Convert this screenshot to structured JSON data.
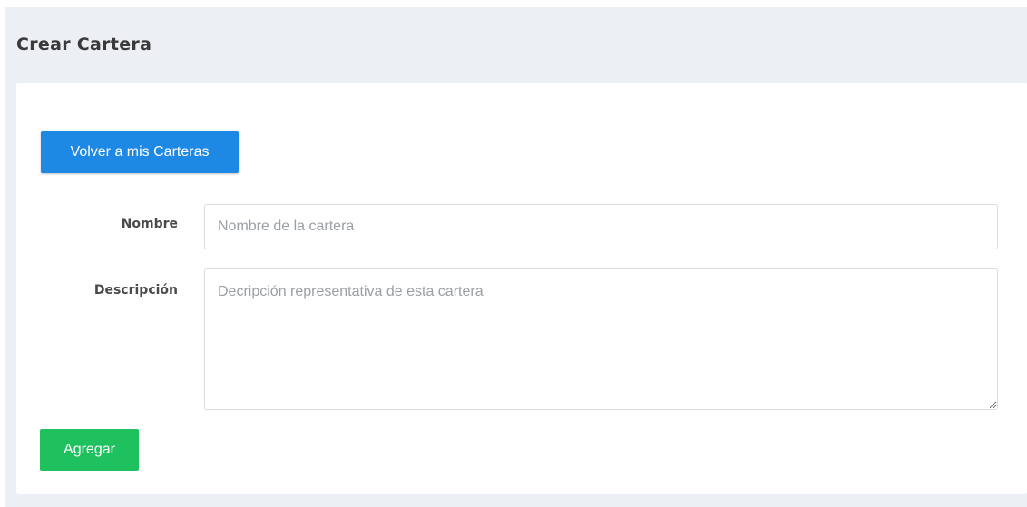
{
  "header": {
    "title": "Crear Cartera"
  },
  "form": {
    "back_button_label": "Volver a mis Carteras",
    "nombre_label": "Nombre",
    "nombre_placeholder": "Nombre de la cartera",
    "nombre_value": "",
    "descripcion_label": "Descripción",
    "descripcion_placeholder": "Decripción representativa de esta cartera",
    "descripcion_value": "",
    "submit_label": "Agregar"
  },
  "colors": {
    "page_background": "#eceff3",
    "back_button": "#1e88e5",
    "submit_button": "#1fc05e"
  }
}
